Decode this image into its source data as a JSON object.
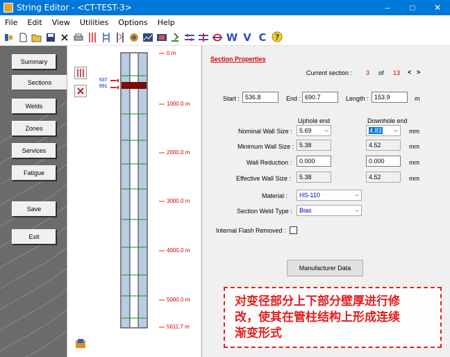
{
  "window": {
    "title": "String Editor - <CT-TEST-3>",
    "controls": {
      "minimize": "–",
      "maximize": "□",
      "close": "✕"
    }
  },
  "menu": [
    "File",
    "Edit",
    "View",
    "Utilities",
    "Options",
    "Help"
  ],
  "toolbar": {
    "icons": [
      "new-string-icon",
      "new-file-icon",
      "open-folder-icon",
      "save-icon",
      "delete-icon",
      "print-icon",
      "sections-view-icon",
      "welds-view-icon",
      "zones-view-icon",
      "services-icon",
      "chart-icon",
      "report-icon",
      "certificate-icon",
      "compare-icon",
      "balance-icon",
      "flow-icon",
      "help-icon"
    ],
    "letters": [
      "W",
      "V",
      "C"
    ]
  },
  "nav": {
    "buttons": [
      "Summary",
      "Sections",
      "Welds",
      "Zones",
      "Services",
      "Fatigue",
      "Save",
      "Exit"
    ],
    "active": "Sections"
  },
  "pipe": {
    "depth_labels": [
      "0 m",
      "1000.0 m",
      "2000.0 m",
      "3000.0 m",
      "4000.0 m",
      "5000.0 m",
      "5611.7 m"
    ],
    "section_start_label": "537",
    "section_end_label": "691"
  },
  "section": {
    "title": "Section Properties",
    "current_label": "Current section :",
    "current": "3",
    "of_label": "of",
    "total": "13",
    "prev": "<",
    "next": ">",
    "start_label": "Start :",
    "start": "536.8",
    "end_label": "End :",
    "end": "690.7",
    "length_label": "Length :",
    "length": "153.9",
    "length_unit": "m",
    "uphole_header": "Uphole end",
    "downhole_header": "Downhole end",
    "nominal_label": "Nominal Wall Size :",
    "nominal_up": "5.69",
    "nominal_down": "4.83",
    "minimum_label": "Minimum Wall Size :",
    "minimum_up": "5.38",
    "minimum_down": "4.52",
    "reduction_label": "Wall Reduction :",
    "reduction_up": "0.000",
    "reduction_down": "0.000",
    "effective_label": "Effective Wall Size :",
    "effective_up": "5.38",
    "effective_down": "4.52",
    "unit_mm": "mm",
    "material_label": "Material :",
    "material": "HS-110",
    "weld_type_label": "Section Weld Type :",
    "weld_type": "Bias",
    "flash_label": "Internal Flash Removed :",
    "manufacturer_button": "Manufacturer Data"
  },
  "annotation": {
    "line1": "对变径部分上下部分壁厚进行修",
    "line2": "改，使其在管柱结构上形成连续",
    "line3": "渐变形式"
  }
}
